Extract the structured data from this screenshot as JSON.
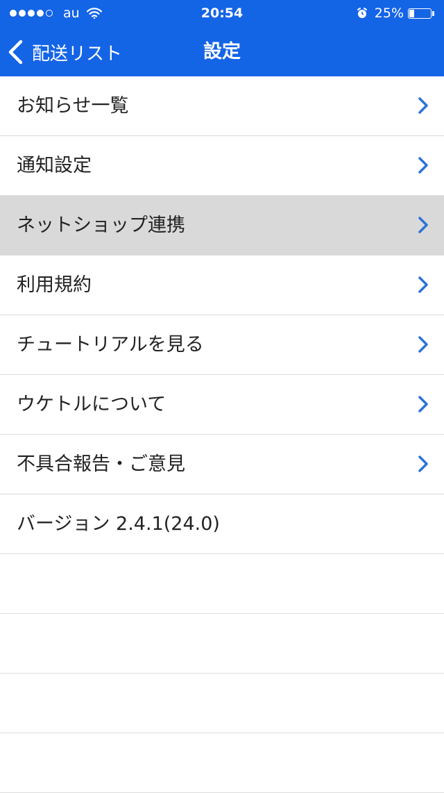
{
  "status_bar": {
    "carrier": "au",
    "time": "20:54",
    "battery_percent": "25%",
    "battery_level": 0.25,
    "signal_bars_filled": 4,
    "signal_bars_total": 5
  },
  "nav": {
    "back_label": "配送リスト",
    "title": "設定"
  },
  "menu": {
    "items": [
      {
        "label": "お知らせ一覧",
        "has_chevron": true,
        "selected": false
      },
      {
        "label": "通知設定",
        "has_chevron": true,
        "selected": false
      },
      {
        "label": "ネットショップ連携",
        "has_chevron": true,
        "selected": true
      },
      {
        "label": "利用規約",
        "has_chevron": true,
        "selected": false
      },
      {
        "label": "チュートリアルを見る",
        "has_chevron": true,
        "selected": false
      },
      {
        "label": "ウケトルについて",
        "has_chevron": true,
        "selected": false
      },
      {
        "label": "不具合報告・ご意見",
        "has_chevron": true,
        "selected": false
      },
      {
        "label": "バージョン 2.4.1(24.0)",
        "has_chevron": false,
        "selected": false
      }
    ],
    "empty_rows": 4
  },
  "colors": {
    "brand_blue": "#1464e6",
    "chevron_blue": "#2a72d9",
    "selected_row": "#d9d9d9",
    "separator": "#dcdcdc"
  },
  "icons": {
    "back": "chevron-left-icon",
    "row": "chevron-right-icon",
    "wifi": "wifi-icon",
    "alarm": "alarm-clock-icon",
    "battery": "battery-icon"
  }
}
